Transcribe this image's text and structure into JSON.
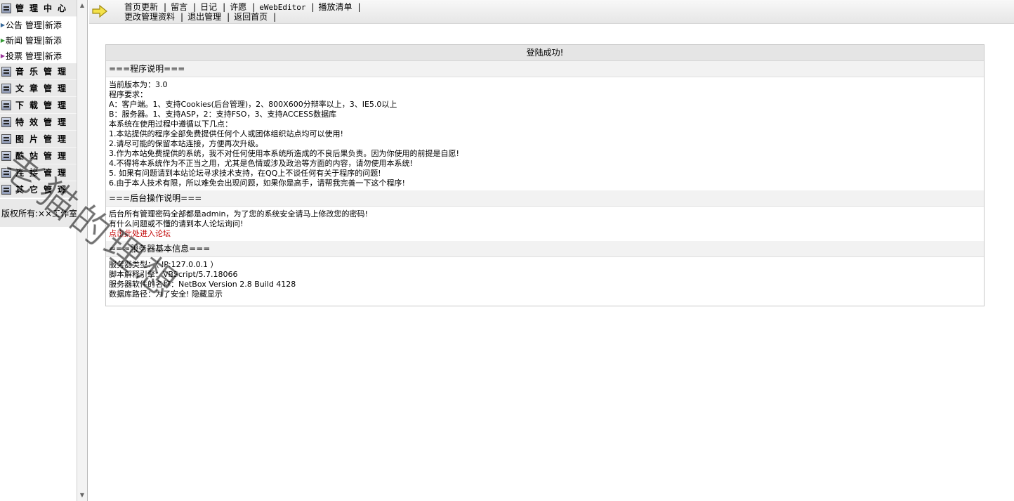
{
  "sidebar": {
    "header": "管理中心",
    "sub_items": [
      {
        "name": "公告",
        "manage": "管理",
        "add": "新添"
      },
      {
        "name": "新闻",
        "manage": "管理",
        "add": "新添"
      },
      {
        "name": "投票",
        "manage": "管理",
        "add": "新添"
      }
    ],
    "groups": [
      "音乐管理",
      "文章管理",
      "下载管理",
      "特效管理",
      "图片管理",
      "酷站管理",
      "连接管理",
      "其它管理"
    ],
    "copyright": "版权所有:××工作室"
  },
  "nav": {
    "row1": [
      "首页更新",
      "留言",
      "日记",
      "许愿",
      "eWebEditor",
      "播放清单"
    ],
    "row2": [
      "更改管理资料",
      "退出管理",
      "返回首页"
    ]
  },
  "panel": {
    "title": "登陆成功!",
    "section1": {
      "heading": "===程序说明===",
      "lines": [
        "当前版本为：3.0",
        "程序要求：",
        "A：客户端。1、支持Cookies(后台管理)，2、800X600分辩率以上，3、IE5.0以上",
        "B：服务器。1、支持ASP，2：支持FSO，3、支持ACCESS数据库",
        "本系统在使用过程中遵循以下几点：",
        "1.本站提供的程序全部免费提供任何个人或团体组织站点均可以使用!",
        "2.请尽可能的保留本站连接，方便再次升级。",
        "3.作为本站免费提供的系统，我不对任何使用本系统所造成的不良后果负责。因为你使用的前提是自愿!",
        "4.不得将本系统作为不正当之用，尤其是色情或涉及政治等方面的内容，请勿使用本系统!",
        "5. 如果有问题请到本站论坛寻求技术支持，在QQ上不谈任何有关于程序的问题!",
        "6.由于本人技术有限，所以难免会出现问题，如果你是高手，请帮我完善一下这个程序!"
      ]
    },
    "section2": {
      "heading": "===后台操作说明===",
      "lines": [
        "后台所有管理密码全部都是admin，为了您的系统安全请马上修改您的密码!",
        "有什么问题或不懂的请到本人论坛询问!"
      ],
      "link": "点击此处进入论坛"
    },
    "section3": {
      "heading": "===服务器基本信息===",
      "lines": [
        "服务器类型：（ IP:127.0.0.1 ）",
        "脚本解释引擎：VBScript/5.7.18066",
        "服务器软件的名称：NetBox Version 2.8 Build 4128",
        "数据库路径：为了安全! 隐藏显示"
      ]
    }
  },
  "watermark": "老猫的理想"
}
